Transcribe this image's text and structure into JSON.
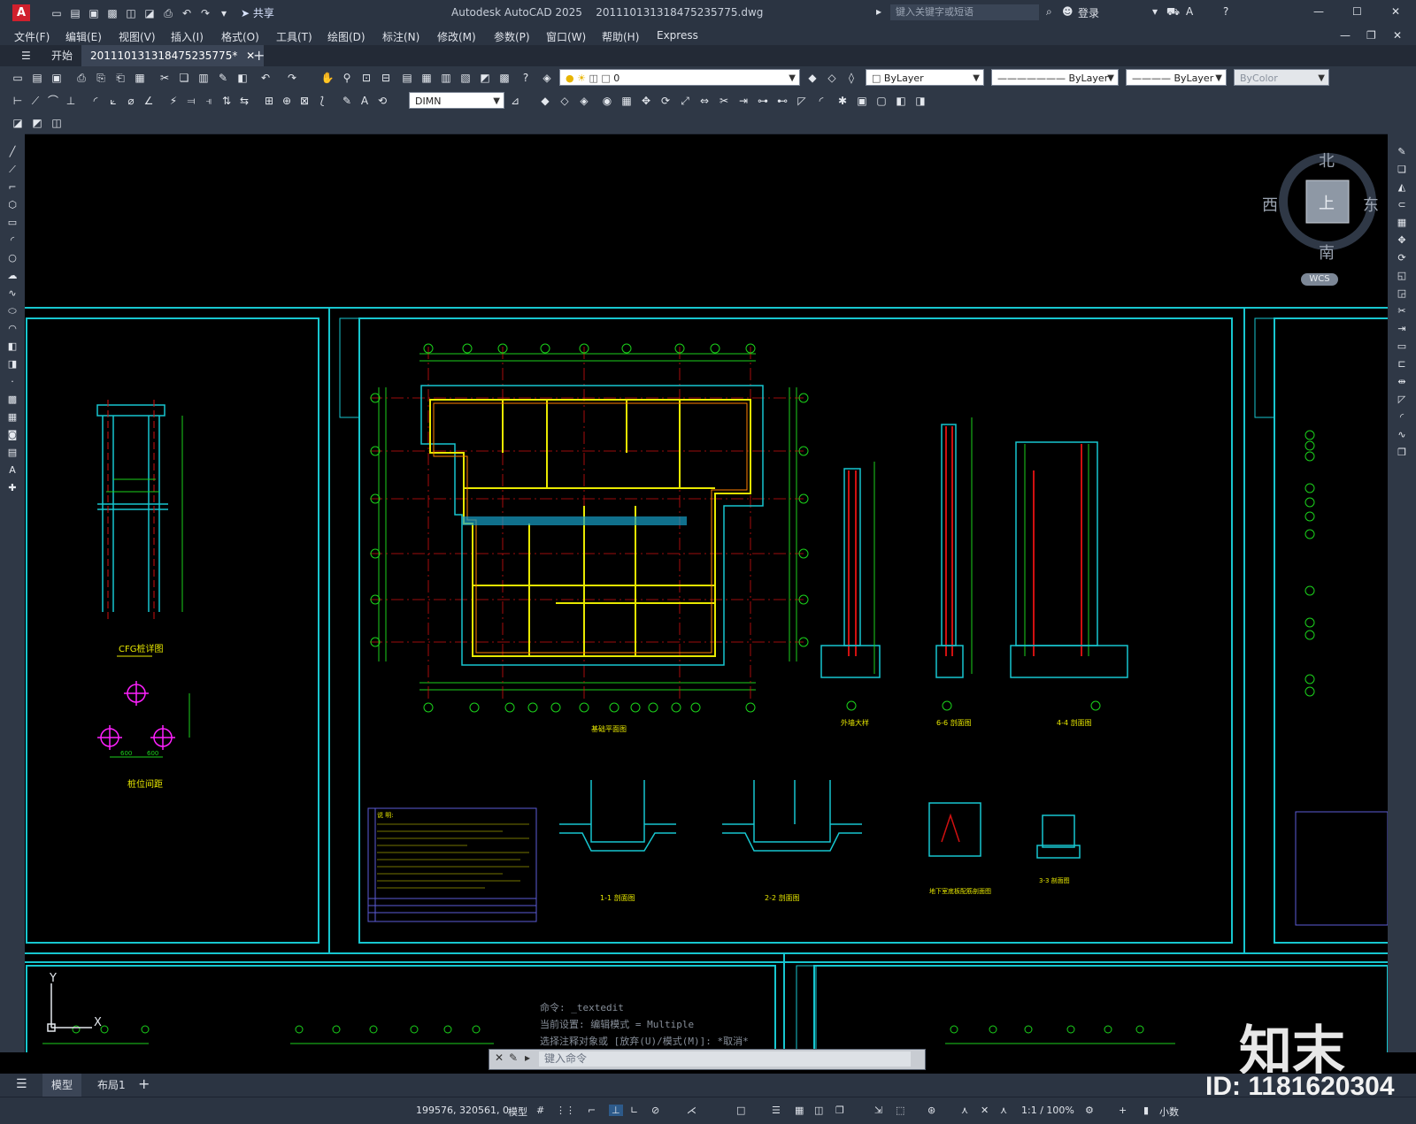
{
  "app": {
    "logo": "A",
    "title": "Autodesk AutoCAD 2025",
    "filename": "201110131318475235775.dwg",
    "share": "共享",
    "search_placeholder": "键入关键字或短语",
    "login": "登录"
  },
  "menu": [
    "文件(F)",
    "编辑(E)",
    "视图(V)",
    "插入(I)",
    "格式(O)",
    "工具(T)",
    "绘图(D)",
    "标注(N)",
    "修改(M)",
    "参数(P)",
    "窗口(W)",
    "帮助(H)",
    "Express"
  ],
  "tabs": {
    "start": "开始",
    "doc": "201110131318475235775*",
    "add": "+"
  },
  "toolbar": {
    "layer": "0",
    "color": "ByLayer",
    "linetype": "ByLayer",
    "lineweight": "ByLayer",
    "plotstyle": "ByColor",
    "dimstyle": "DIMN"
  },
  "viewcube": {
    "north": "北",
    "south": "南",
    "east": "东",
    "west": "西",
    "top": "上",
    "wcs": "WCS"
  },
  "command": {
    "history": [
      "命令: _textedit",
      "当前设置: 编辑模式 = Multiple",
      "选择注释对象或 [放弃(U)/模式(M)]: *取消*"
    ],
    "input_placeholder": "键入命令"
  },
  "drawing": {
    "plan_title": "基础平面图",
    "cfg_title": "CFG桩详图",
    "pile_title": "桩位间距",
    "notes_title": "说 明:",
    "section_1_1": "1-1 剖面图",
    "section_2_2": "2-2 剖面图",
    "section_3_3": "3-3 剖面图",
    "section_4_4": "4-4 剖面图",
    "section_5_5": "外墙大样",
    "section_6_6": "6-6 剖面图",
    "basement_detail": "地下室底板配筋剖面图",
    "cfg_spacing": [
      "600",
      "600"
    ]
  },
  "layout_tabs": {
    "model": "模型",
    "layout1": "布局1"
  },
  "status": {
    "coords": "199576, 320561, 0",
    "space": "模型",
    "scale": "1:1 / 100%",
    "units": "小数"
  },
  "watermark": {
    "brand": "知末",
    "id": "ID: 1181620304"
  }
}
